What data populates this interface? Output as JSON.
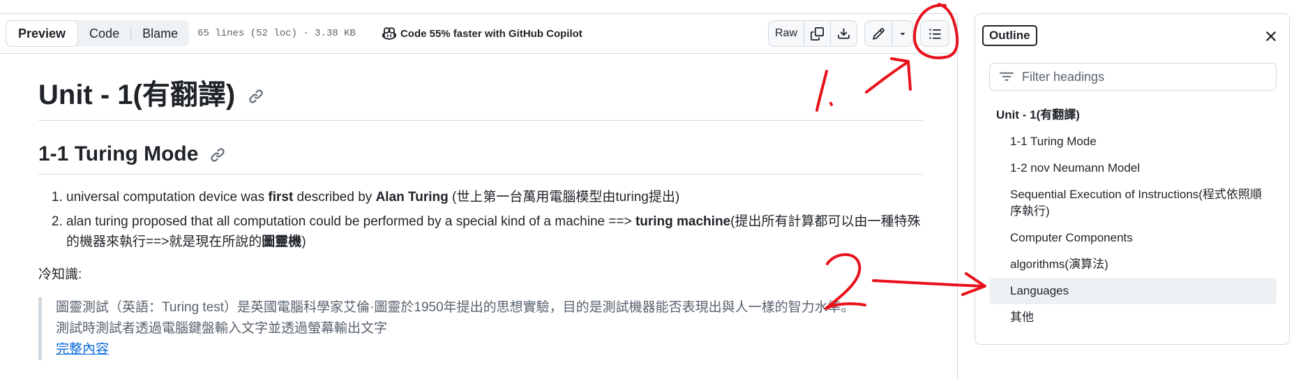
{
  "toolbar": {
    "tabs": [
      {
        "label": "Preview",
        "active": true
      },
      {
        "label": "Code",
        "active": false
      },
      {
        "label": "Blame",
        "active": false
      }
    ],
    "file_info": "65 lines (52 loc) · 3.38 KB",
    "copilot_text": "Code 55% faster with GitHub Copilot",
    "raw_label": "Raw",
    "icons": [
      "copy-icon",
      "download-icon",
      "pencil-icon",
      "caret-down-icon",
      "list-unordered-icon"
    ]
  },
  "content": {
    "h1": "Unit - 1(有翻譯)",
    "h2": "1-1 Turing Mode",
    "list": [
      {
        "p1": "universal computation device was ",
        "b1": "first",
        "p2": " described by ",
        "b2": "Alan Turing",
        "p3": " (世上第一台萬用電腦模型由turing提出)"
      },
      {
        "p1": "alan turing proposed that all computation could be performed by a special kind of a machine ==> ",
        "b1": "turing machine",
        "p2": "(提出所有計算都可以由一種特殊的機器來執行==>就是現在所說的",
        "b2": "圖靈機",
        "p3": ")"
      }
    ],
    "trivia": "冷知識:",
    "quote": {
      "line1": "圖靈測試（英語：Turing test）是英國電腦科學家艾倫·圖靈於1950年提出的思想實驗，目的是測試機器能否表現出與人一樣的智力水準。",
      "line2": "測試時測試者透過電腦鍵盤輸入文字並透過螢幕輸出文字",
      "link": "完整內容"
    }
  },
  "outline": {
    "title": "Outline",
    "filter_placeholder": "Filter headings",
    "items": [
      {
        "label": "Unit - 1(有翻譯)",
        "level": 1
      },
      {
        "label": "1-1 Turing Mode",
        "level": 2
      },
      {
        "label": "1-2 nov Neumann Model",
        "level": 2
      },
      {
        "label": "Sequential Execution of Instructions(程式依照順序執行)",
        "level": 2
      },
      {
        "label": "Computer Components",
        "level": 2
      },
      {
        "label": "algorithms(演算法)",
        "level": 2
      },
      {
        "label": "Languages",
        "level": 2,
        "active": true
      },
      {
        "label": "其他",
        "level": 2
      }
    ]
  },
  "annotations": {
    "mark1": "1.",
    "mark2": "2",
    "color": "#e8111b"
  }
}
